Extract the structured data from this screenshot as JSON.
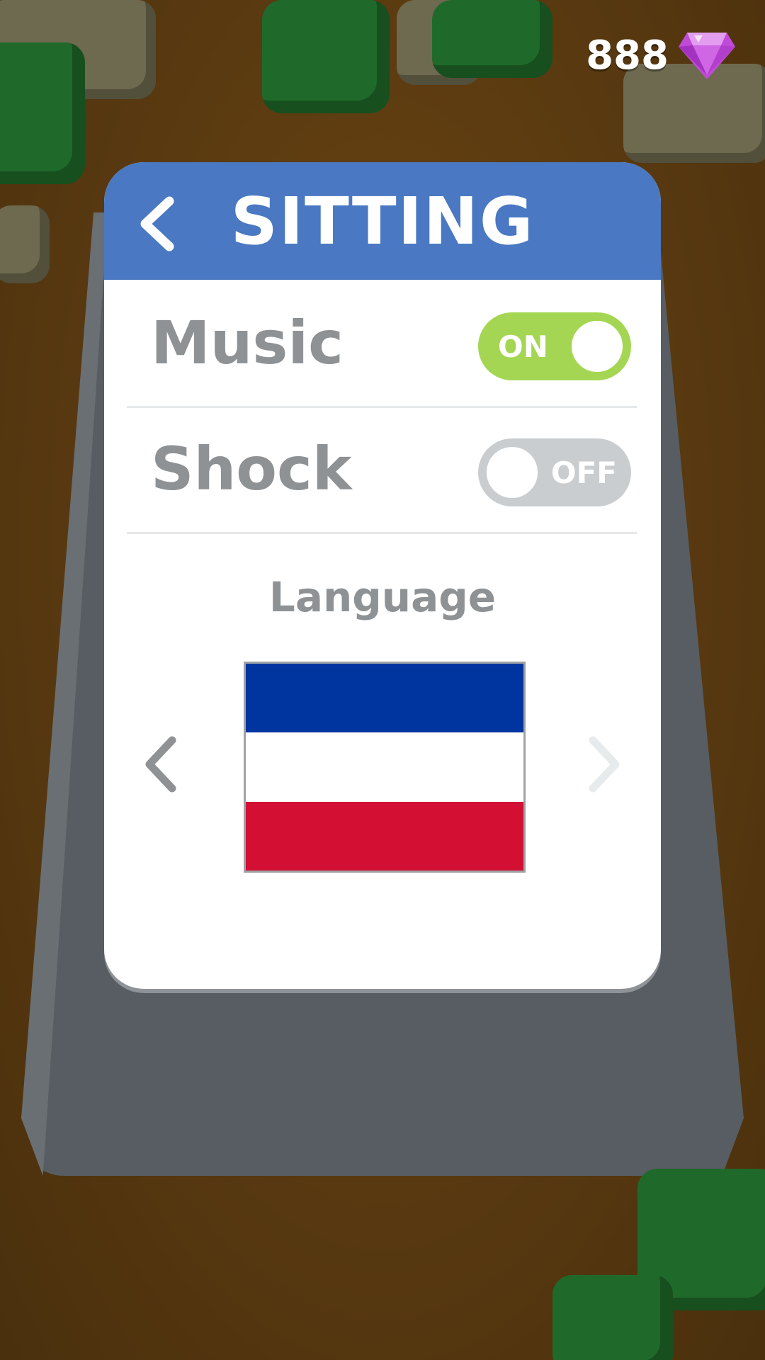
{
  "gems": {
    "count": "888",
    "icon": "gem-icon"
  },
  "settings": {
    "title": "SITTING",
    "back_icon": "chevron-left-icon",
    "music": {
      "label": "Music",
      "state": "ON",
      "enabled": true
    },
    "shock": {
      "label": "Shock",
      "state": "OFF",
      "enabled": false
    },
    "language": {
      "label": "Language",
      "prev_icon": "chevron-left-icon",
      "next_icon": "chevron-right-icon",
      "flag_stripes": [
        "#0035a0",
        "#ffffff",
        "#d31034"
      ]
    }
  },
  "colors": {
    "header": "#4a78c2",
    "toggle_on": "#a5d653",
    "toggle_off": "#c9cdd0",
    "label_gray": "#8f9295"
  }
}
